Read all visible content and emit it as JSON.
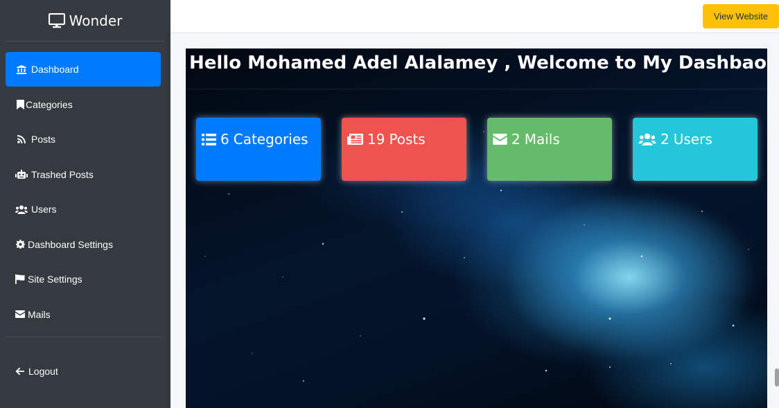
{
  "brand": {
    "name": "Wonder",
    "icon": "desktop-icon"
  },
  "sidebar": {
    "items": [
      {
        "label": "Dashboard",
        "icon": "bank-icon",
        "active": true
      },
      {
        "label": "Categories",
        "icon": "bookmark-icon"
      },
      {
        "label": "Posts",
        "icon": "rss-icon"
      },
      {
        "label": "Trashed Posts",
        "icon": "robot-icon"
      },
      {
        "label": "Users",
        "icon": "users-icon"
      },
      {
        "label": "Dashboard Settings",
        "icon": "gear-icon"
      },
      {
        "label": "Site Settings",
        "icon": "flag-icon"
      },
      {
        "label": "Mails",
        "icon": "envelope-icon"
      }
    ],
    "logout": {
      "label": "Logout",
      "icon": "arrow-left-icon"
    }
  },
  "topbar": {
    "view_website": "View Website"
  },
  "main": {
    "welcome": "Hello Mohamed Adel Alalamey , Welcome to My Dashbaord",
    "cards": [
      {
        "count": "6",
        "label": "Categories",
        "icon": "list-icon",
        "color": "#007bff"
      },
      {
        "count": "19",
        "label": "Posts",
        "icon": "newspaper-icon",
        "color": "#ef5350"
      },
      {
        "count": "2",
        "label": "Mails",
        "icon": "envelope-icon",
        "color": "#66bb6a"
      },
      {
        "count": "2",
        "label": "Users",
        "icon": "users-icon",
        "color": "#26c6da"
      }
    ]
  },
  "colors": {
    "sidebar": "#343a40",
    "active": "#007bff",
    "view_button": "#ffc107"
  }
}
